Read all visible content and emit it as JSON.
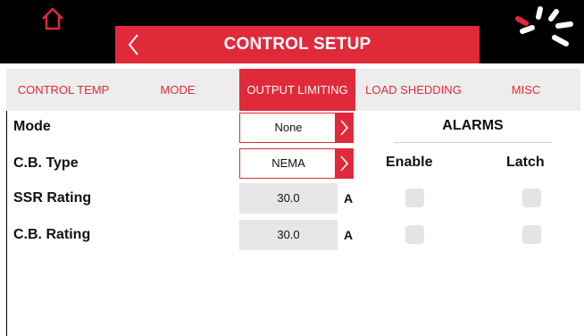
{
  "header": {
    "title": "CONTROL SETUP",
    "icons": {
      "home": "home-icon",
      "back": "chevron-left-icon",
      "busy": "loading-spinner-icon"
    },
    "colors": {
      "accent": "#e02a3a",
      "bar": "#000000"
    }
  },
  "tabs": [
    {
      "label": "CONTROL TEMP",
      "active": false
    },
    {
      "label": "MODE",
      "active": false
    },
    {
      "label": "OUTPUT LIMITING",
      "active": true
    },
    {
      "label": "LOAD SHEDDING",
      "active": false
    },
    {
      "label": "MISC",
      "active": false
    }
  ],
  "settings": {
    "mode": {
      "label": "Mode",
      "value": "None"
    },
    "cb_type": {
      "label": "C.B. Type",
      "value": "NEMA"
    },
    "ssr_rating": {
      "label": "SSR Rating",
      "value": "30.0",
      "unit": "A"
    },
    "cb_rating": {
      "label": "C.B. Rating",
      "value": "30.0",
      "unit": "A"
    }
  },
  "alarms": {
    "title": "ALARMS",
    "enable_label": "Enable",
    "latch_label": "Latch",
    "ssr_enable": false,
    "ssr_latch": false,
    "cb_enable": false,
    "cb_latch": false
  }
}
